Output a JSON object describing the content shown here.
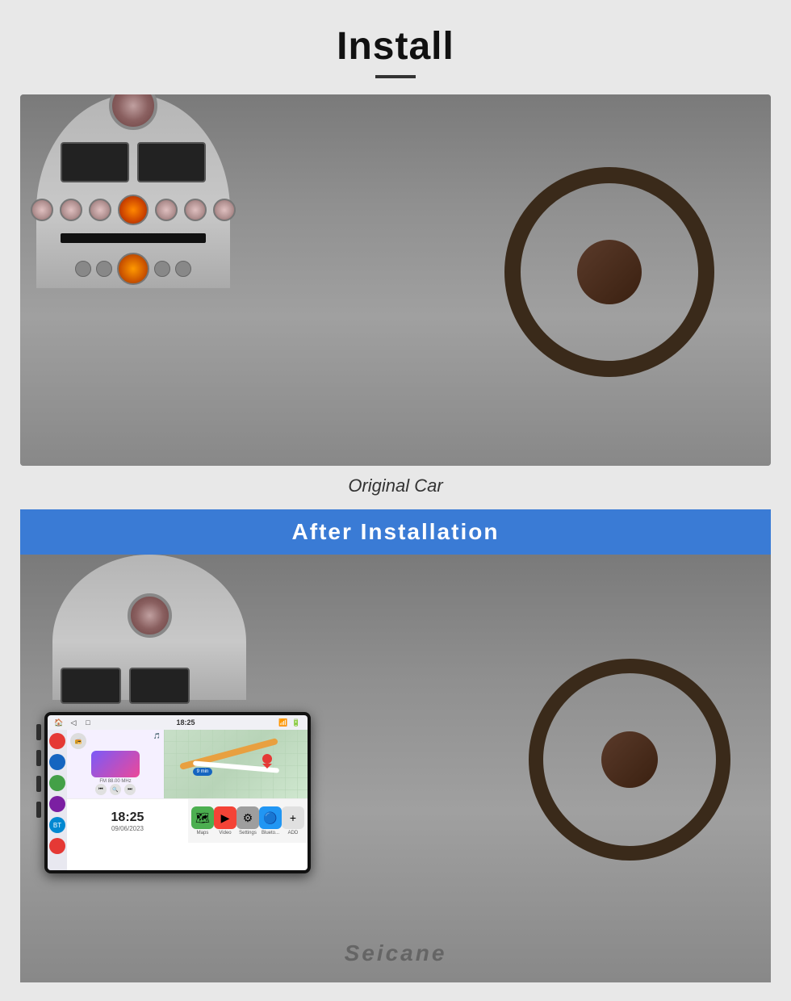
{
  "page": {
    "title": "Install",
    "title_underline": true,
    "original_car_label": "Original Car",
    "after_installation_label": "After  Installation",
    "watermark": "Seicane",
    "screen": {
      "time": "18:25",
      "bottom_time": "18:25",
      "bottom_date": "09/06/2023",
      "freq": "FM 88.00 MHz",
      "map_bubble": "9 min",
      "apps": [
        {
          "label": "Maps",
          "icon": "🗺"
        },
        {
          "label": "Video",
          "icon": "▶"
        },
        {
          "label": "Settings",
          "icon": "⚙"
        },
        {
          "label": "Blueto...",
          "icon": "🔵"
        },
        {
          "label": "ADD",
          "icon": "+"
        }
      ]
    }
  }
}
